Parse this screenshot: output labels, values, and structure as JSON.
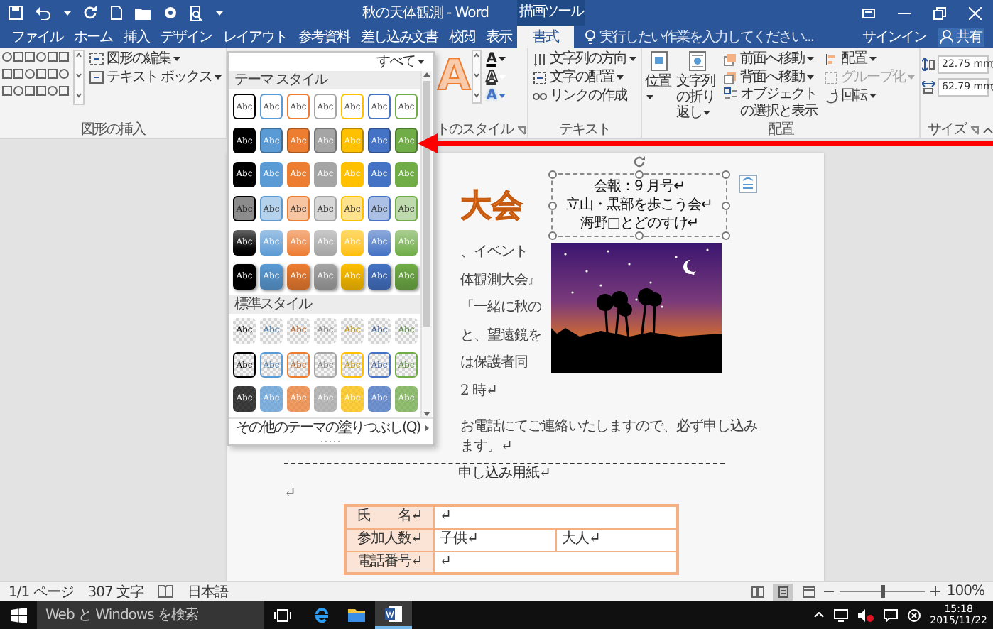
{
  "title_bar": {
    "title": "秋の天体観測 - Word",
    "context_group": "描画ツール"
  },
  "tabs": [
    {
      "label": "ファイル",
      "selected": false
    },
    {
      "label": "ホーム",
      "selected": false
    },
    {
      "label": "挿入",
      "selected": false
    },
    {
      "label": "デザイン",
      "selected": false
    },
    {
      "label": "レイアウト",
      "selected": false
    },
    {
      "label": "参考資料",
      "selected": false
    },
    {
      "label": "差し込み文書",
      "selected": false
    },
    {
      "label": "校閲",
      "selected": false
    },
    {
      "label": "表示",
      "selected": false
    },
    {
      "label": "書式",
      "selected": true
    }
  ],
  "tell_me": {
    "placeholder": "実行したい作業を入力してください..."
  },
  "account": {
    "sign_in": "サインイン",
    "share": "共有"
  },
  "ribbon": {
    "insert_shapes": {
      "buttons": [
        {
          "label": "図形の編集",
          "dropdown": true
        },
        {
          "label": "テキスト ボックス",
          "dropdown": true
        }
      ],
      "label": "図形の挿入"
    },
    "wordart_styles": {
      "preview": "A",
      "tools": [
        "A",
        "A",
        "A"
      ],
      "label": "トのスタイル"
    },
    "text": {
      "buttons": [
        {
          "label": "文字列の方向",
          "dropdown": true
        },
        {
          "label": "文字の配置",
          "dropdown": true
        },
        {
          "label": "リンクの作成",
          "dropdown": false
        }
      ],
      "label": "テキスト"
    },
    "arrange": {
      "large_buttons": [
        {
          "label": "位置",
          "dropdown": true
        },
        {
          "label": "文字列の折り返し",
          "dropdown": true
        }
      ],
      "buttons": [
        {
          "label": "前面へ移動",
          "dropdown": true,
          "disabled": false
        },
        {
          "label": "背面へ移動",
          "dropdown": true,
          "disabled": false
        },
        {
          "label": "オブジェクトの選択と表示",
          "dropdown": false,
          "disabled": false
        },
        {
          "label": "配置",
          "dropdown": true,
          "disabled": false
        },
        {
          "label": "グループ化",
          "dropdown": true,
          "disabled": true
        },
        {
          "label": "回転",
          "dropdown": true,
          "disabled": false
        }
      ],
      "label": "配置"
    },
    "size": {
      "fields": [
        "22.75 mm",
        "62.79 mm"
      ],
      "label": "サイズ"
    }
  },
  "gallery": {
    "filter": "すべて",
    "columns": [
      {
        "color": "#000000"
      },
      {
        "color": "#5b9bd5"
      },
      {
        "color": "#ed7d31"
      },
      {
        "color": "#a5a5a5"
      },
      {
        "color": "#ffc000"
      },
      {
        "color": "#4472c4"
      },
      {
        "color": "#70ad47"
      }
    ],
    "sections": [
      {
        "title": "テーマ スタイル",
        "rows": [
          {
            "kind": "outline",
            "cells": [
              "Abc",
              "Abc",
              "Abc",
              "Abc",
              "Abc",
              "Abc",
              "Abc"
            ]
          },
          {
            "kind": "solid",
            "cells": [
              "Abc",
              "Abc",
              "Abc",
              "Abc",
              "Abc",
              "Abc",
              "Abc"
            ]
          },
          {
            "kind": "plain",
            "cells": [
              "Abc",
              "Abc",
              "Abc",
              "Abc",
              "Abc",
              "Abc",
              "Abc"
            ]
          },
          {
            "kind": "light",
            "cells": [
              "Abc",
              "Abc",
              "Abc",
              "Abc",
              "Abc",
              "Abc",
              "Abc"
            ]
          },
          {
            "kind": "gradient",
            "cells": [
              "Abc",
              "Abc",
              "Abc",
              "Abc",
              "Abc",
              "Abc",
              "Abc"
            ]
          },
          {
            "kind": "shadow",
            "cells": [
              "Abc",
              "Abc",
              "Abc",
              "Abc",
              "Abc",
              "Abc",
              "Abc"
            ]
          }
        ]
      },
      {
        "title": "標準スタイル",
        "rows": [
          {
            "kind": "checker-text",
            "cells": [
              "Abc",
              "Abc",
              "Abc",
              "Abc",
              "Abc",
              "Abc",
              "Abc"
            ]
          },
          {
            "kind": "checker-outline",
            "cells": [
              "Abc",
              "Abc",
              "Abc",
              "Abc",
              "Abc",
              "Abc",
              "Abc"
            ]
          },
          {
            "kind": "checker-fill",
            "cells": [
              "Abc",
              "Abc",
              "Abc",
              "Abc",
              "Abc",
              "Abc",
              "Abc"
            ]
          }
        ]
      }
    ],
    "more": "その他のテーマの塗りつぶし(Q)"
  },
  "document": {
    "wordart": "大会",
    "text_box": [
      "会報：9 月号↵",
      "立山・黒部を歩こう会↵",
      "海野□とどのすけ↵"
    ],
    "side_lines": [
      "、イベント",
      "体観測大会』",
      "「一緒に秋の",
      "と、望遠鏡を",
      "は保護者同"
    ],
    "body_lines": [
      "2 時↵",
      "お電話にてご連絡いたしますので、必ず申し込み",
      "ます。↵"
    ],
    "form_title": "申し込み用紙↵",
    "empty_paragraph": "↵",
    "form_table": {
      "rows": [
        [
          {
            "text": "氏　　名↵"
          },
          {
            "text": "↵",
            "colspan": 2
          }
        ],
        [
          {
            "text": "参加人数↵"
          },
          {
            "text": "子供↵"
          },
          {
            "text": "大人↵"
          }
        ],
        [
          {
            "text": "電話番号↵"
          },
          {
            "text": "↵",
            "colspan": 2
          }
        ]
      ]
    }
  },
  "status_bar": {
    "page": "1/1 ページ",
    "words": "307 文字",
    "language": "日本語",
    "views": [
      {
        "selected": false
      },
      {
        "selected": true
      },
      {
        "selected": false
      }
    ],
    "zoom_slider": {
      "level": 0.5
    },
    "zoom": "100%"
  },
  "taskbar": {
    "search": {
      "placeholder": "Web と Windows を検索"
    },
    "apps": [
      {
        "kind": "task-view",
        "active": false
      },
      {
        "kind": "browser",
        "active": false
      },
      {
        "kind": "explorer",
        "active": false
      },
      {
        "kind": "word",
        "active": true
      }
    ],
    "time": "15:18",
    "date": "2015/11/22"
  }
}
